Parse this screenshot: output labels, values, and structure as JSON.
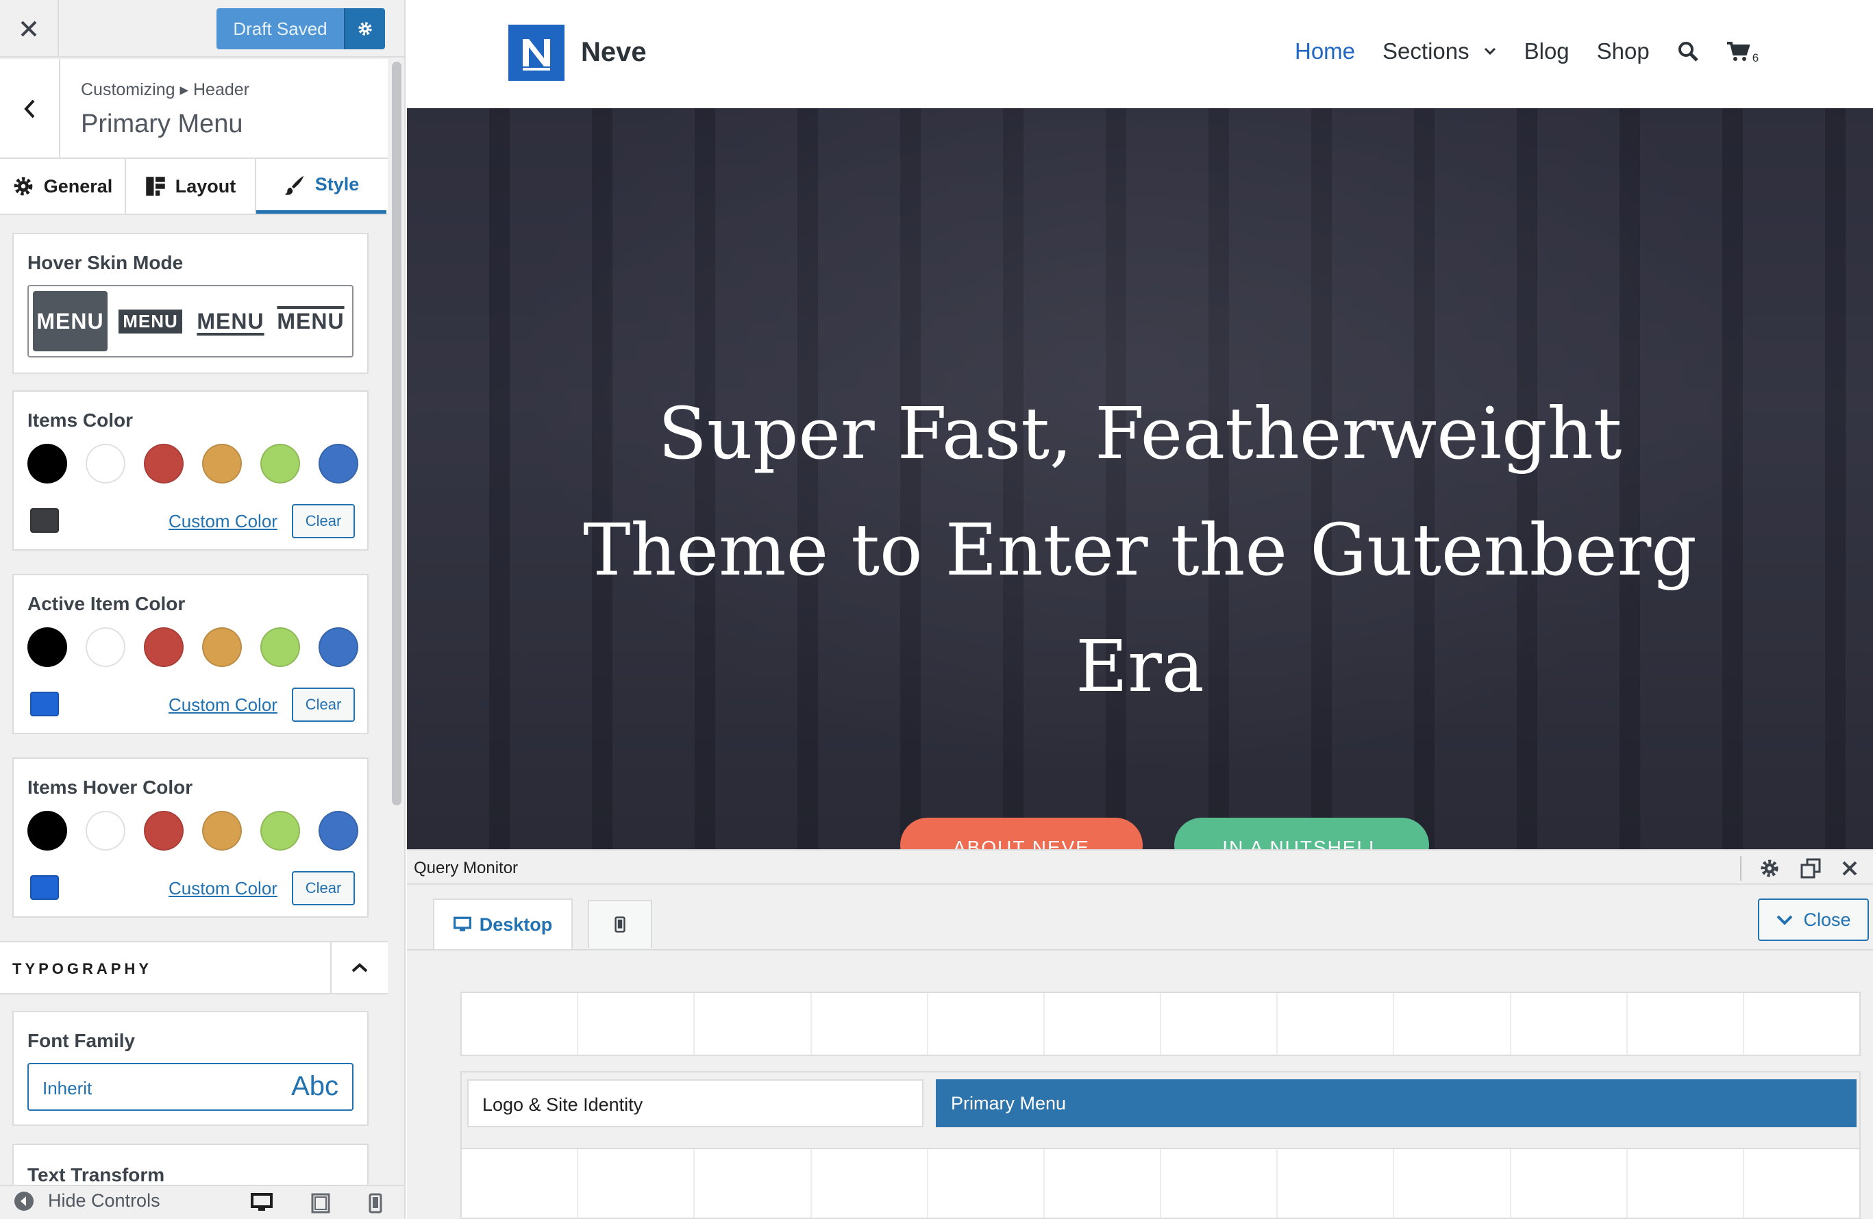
{
  "sidebar": {
    "draft_label": "Draft Saved",
    "breadcrumb": "Customizing ▸ Header",
    "panel_title": "Primary Menu",
    "tabs": [
      {
        "label": "General",
        "icon": "gear-icon"
      },
      {
        "label": "Layout",
        "icon": "layout-icon"
      },
      {
        "label": "Style",
        "icon": "brush-icon"
      }
    ],
    "hover_skin": {
      "title": "Hover Skin Mode",
      "options": [
        "MENU",
        "MENU",
        "MENU",
        "MENU"
      ],
      "selected_index": 0
    },
    "palette": [
      "#000000",
      "#ffffff",
      "#c0473f",
      "#d6a04f",
      "#a3d466",
      "#3d72c4"
    ],
    "color_groups": [
      {
        "title": "Items Color",
        "current": "#3c3d40",
        "custom_label": "Custom Color",
        "clear_label": "Clear"
      },
      {
        "title": "Active Item Color",
        "current": "#1f66d4",
        "custom_label": "Custom Color",
        "clear_label": "Clear"
      },
      {
        "title": "Items Hover Color",
        "current": "#1f66d4",
        "custom_label": "Custom Color",
        "clear_label": "Clear"
      }
    ],
    "typography": {
      "section_label": "TYPOGRAPHY",
      "font_family_title": "Font Family",
      "font_family_value": "Inherit",
      "font_preview": "Abc",
      "text_transform_title": "Text Transform"
    },
    "footer": {
      "hide_controls_label": "Hide Controls"
    }
  },
  "site": {
    "logo_letter": "N",
    "name": "Neve",
    "nav": [
      {
        "label": "Home",
        "active": true
      },
      {
        "label": "Sections",
        "has_dropdown": true
      },
      {
        "label": "Blog"
      },
      {
        "label": "Shop"
      }
    ],
    "cart_count": "6",
    "accent": "#1f66c2",
    "hero_title": "Super Fast, Featherweight Theme to Enter the Gutenberg Era",
    "hero_buttons": [
      {
        "label": "ABOUT NEVE",
        "color": "#ee6c52"
      },
      {
        "label": "IN A NUTSHELL",
        "color": "#57bd8f"
      }
    ]
  },
  "query_monitor": {
    "title": "Query Monitor",
    "tabs": [
      {
        "label": "Desktop",
        "icon": "desktop-icon"
      },
      {
        "label": "",
        "icon": "mobile-icon"
      }
    ],
    "close_label": "Close",
    "builder_items": {
      "logo": "Logo & Site Identity",
      "primary": "Primary Menu"
    }
  }
}
